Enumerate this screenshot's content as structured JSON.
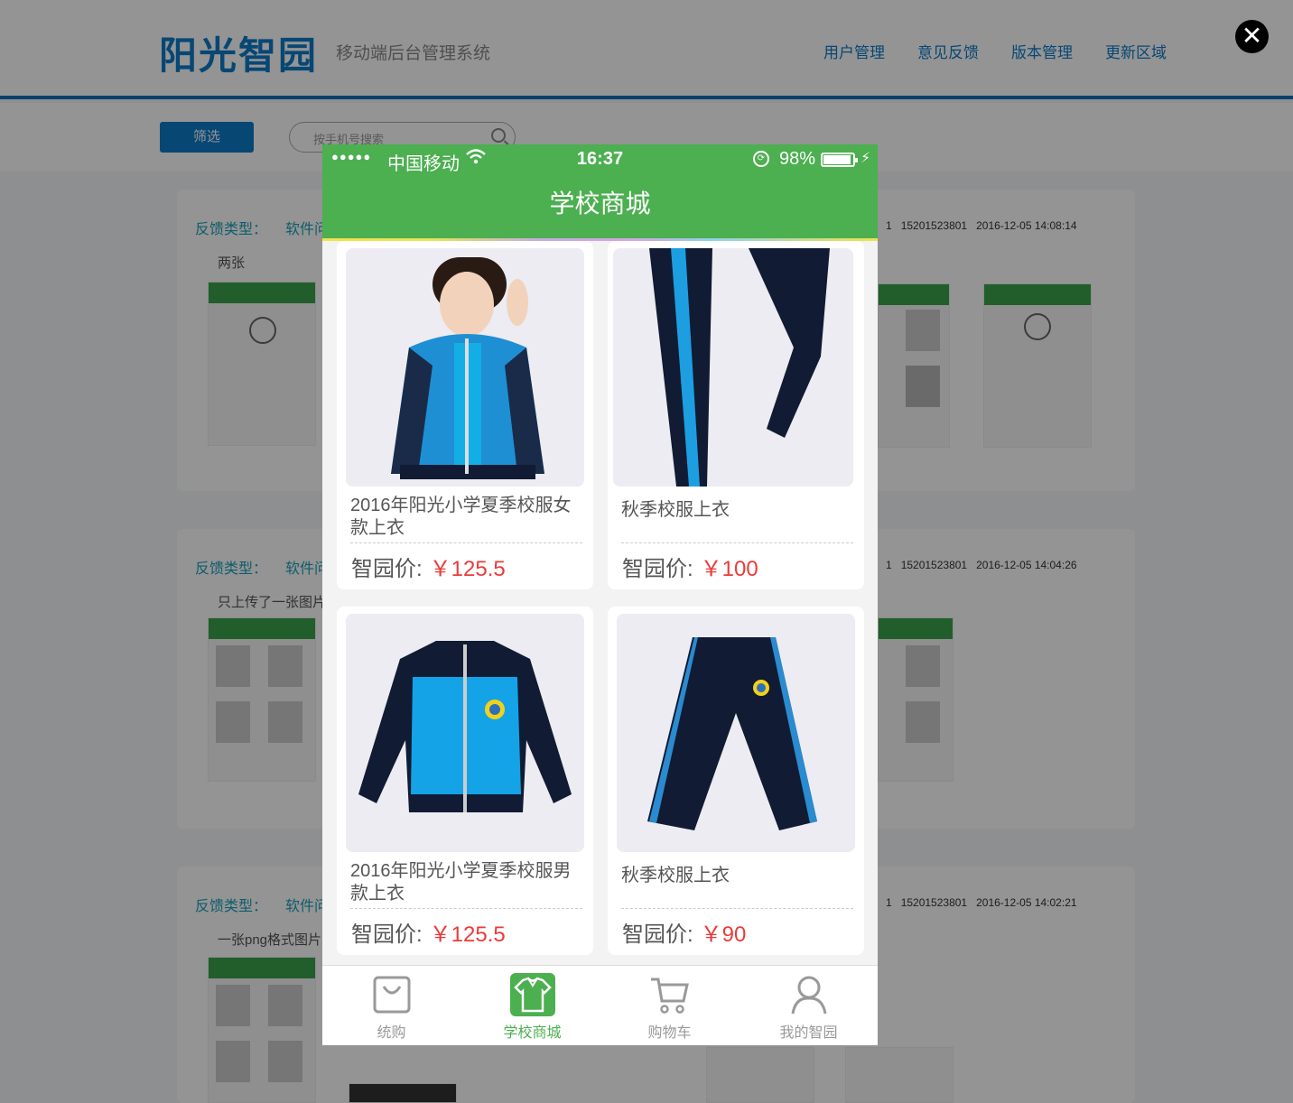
{
  "admin": {
    "logo": "阳光智园",
    "subtitle": "移动端后台管理系统",
    "nav": [
      "用户管理",
      "意见反馈",
      "版本管理",
      "更新区域"
    ],
    "filter_button": "筛选",
    "search_placeholder": "按手机号搜索",
    "cards": [
      {
        "type_label": "反馈类型：",
        "type_value": "软件问",
        "id_tail": "1",
        "phone": "15201523801",
        "time": "2016-12-05 14:08:14",
        "desc": "两张"
      },
      {
        "type_label": "反馈类型：",
        "type_value": "软件问",
        "id_tail": "1",
        "phone": "15201523801",
        "time": "2016-12-05 14:04:26",
        "desc": "只上传了一张图片"
      },
      {
        "type_label": "反馈类型：",
        "type_value": "软件问",
        "id_tail": "1",
        "phone": "15201523801",
        "time": "2016-12-05 14:02:21",
        "desc": "一张png格式图片"
      }
    ]
  },
  "close_label": "✕",
  "phone": {
    "status": {
      "signal": "●●●●●",
      "carrier": "中国移动",
      "time": "16:37",
      "battery": "98%"
    },
    "title": "学校商城",
    "products": [
      {
        "name": "2016年阳光小学夏季校服女款上衣",
        "price_label": "智园价:",
        "price": "￥125.5"
      },
      {
        "name": "秋季校服上衣",
        "price_label": "智园价:",
        "price": "￥100"
      },
      {
        "name": "2016年阳光小学夏季校服男款上衣",
        "price_label": "智园价:",
        "price": "￥125.5"
      },
      {
        "name": "秋季校服上衣",
        "price_label": "智园价:",
        "price": "￥90"
      }
    ],
    "tabs": [
      {
        "label": "统购",
        "icon": "bag-icon"
      },
      {
        "label": "学校商城",
        "icon": "shirt-icon",
        "active": true
      },
      {
        "label": "购物车",
        "icon": "cart-icon"
      },
      {
        "label": "我的智园",
        "icon": "user-icon"
      }
    ]
  },
  "colors": {
    "green": "#4caf50",
    "blue": "#0d7ac8",
    "price_red": "#ec3b3b"
  }
}
